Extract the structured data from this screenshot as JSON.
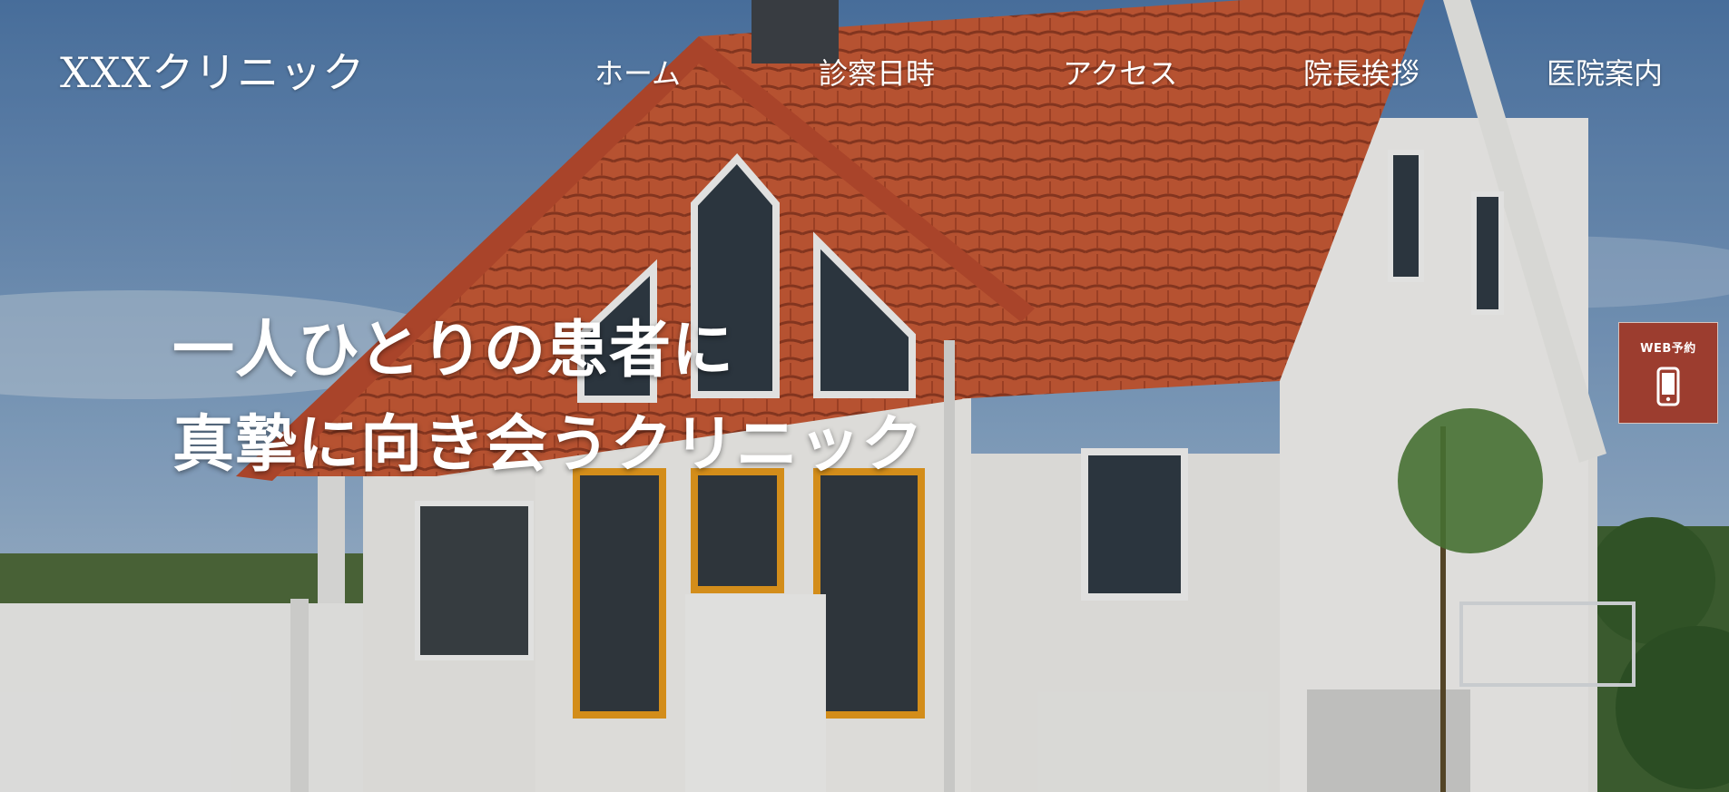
{
  "site": {
    "logo": "XXXクリニック"
  },
  "nav": {
    "items": [
      {
        "label": "ホーム"
      },
      {
        "label": "診察日時"
      },
      {
        "label": "アクセス"
      },
      {
        "label": "院長挨拶"
      },
      {
        "label": "医院案内"
      }
    ]
  },
  "hero": {
    "headline_line1": "一人ひとりの患者に",
    "headline_line2": "真摯に向き会うクリニック",
    "image_icon": "house-photo-icon"
  },
  "web_reserve": {
    "label": "WEB予約",
    "icon": "smartphone-icon",
    "bg_color": "#9c3d2f"
  },
  "colors": {
    "sky": "#6f8fb3",
    "roof": "#c85a36",
    "wall": "#ededeb",
    "accent": "#9c3d2f"
  }
}
